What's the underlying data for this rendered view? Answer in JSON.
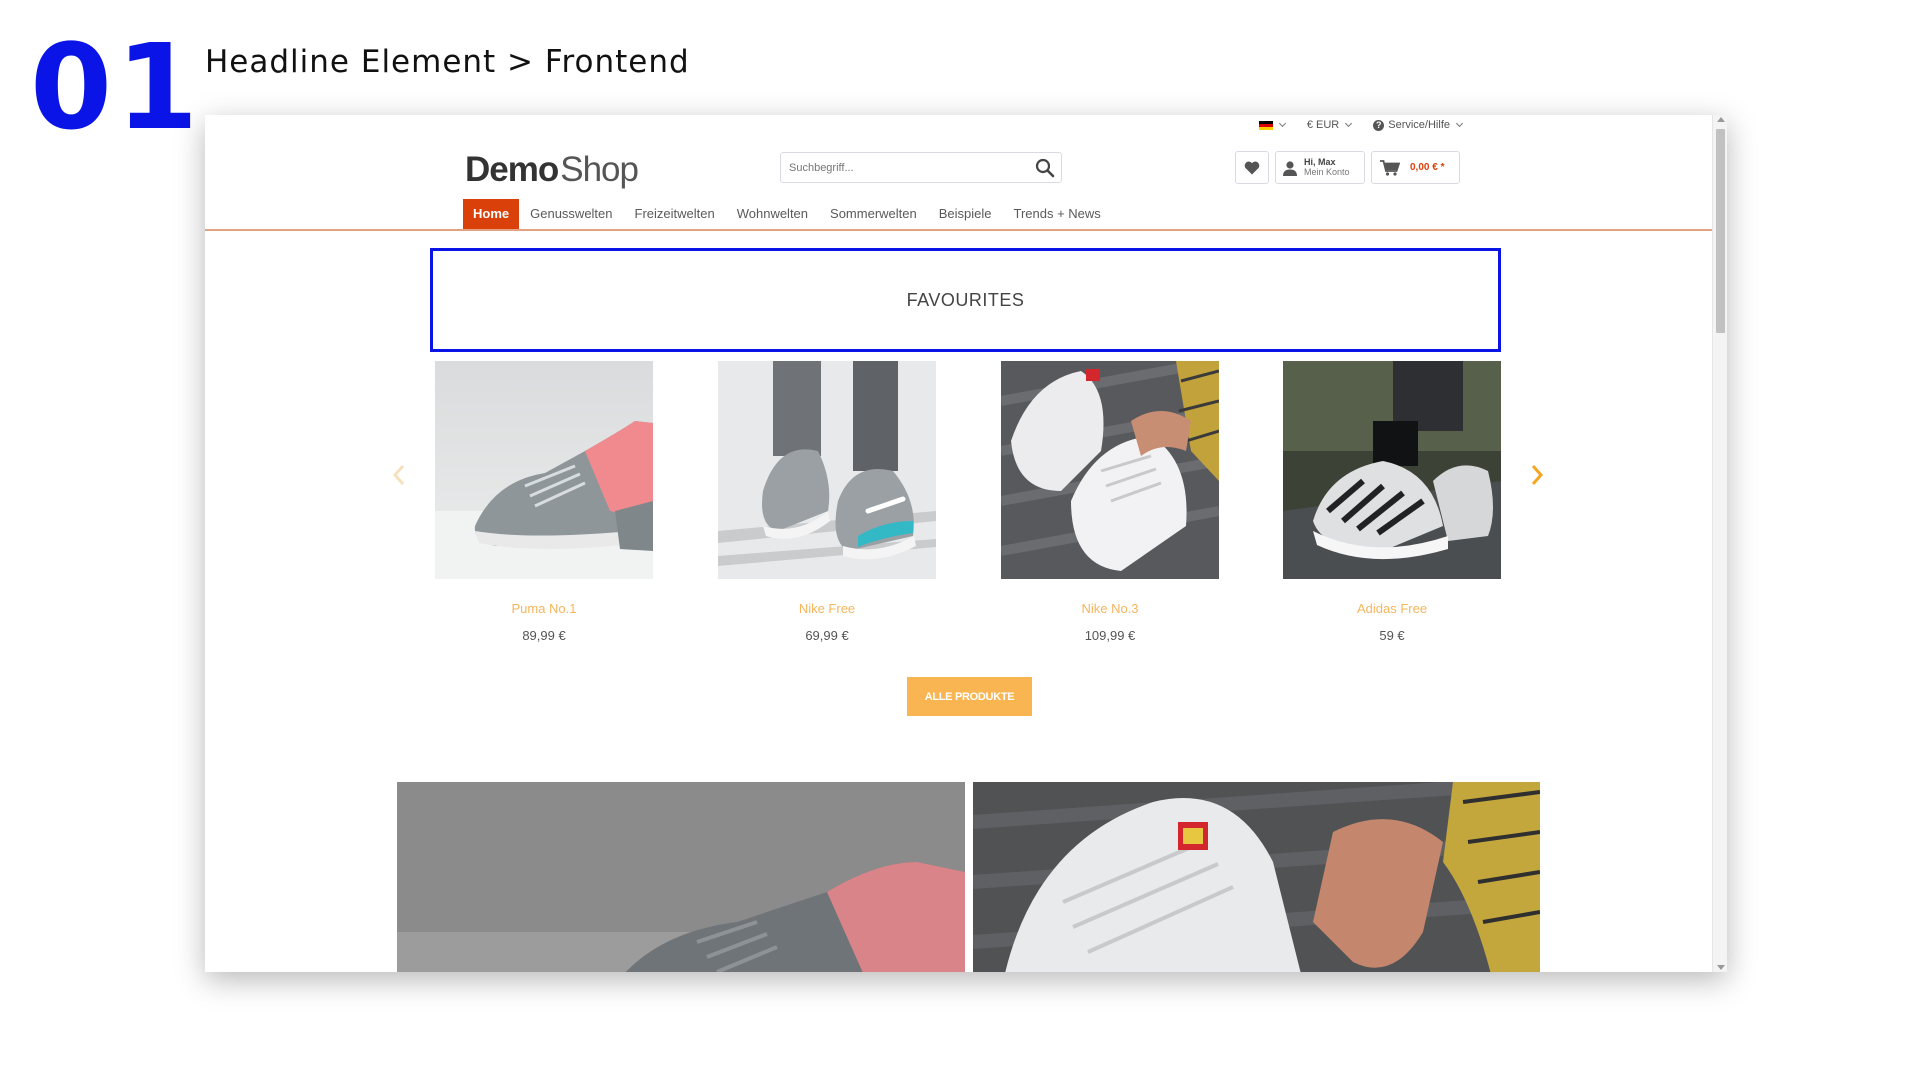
{
  "slide": {
    "number": "01",
    "title": "Headline Element > Frontend"
  },
  "topbar": {
    "currency": "€ EUR",
    "service": "Service/Hilfe"
  },
  "logo": {
    "part1": "Demo",
    "part2": "Shop"
  },
  "search": {
    "placeholder": "Suchbegriff..."
  },
  "account": {
    "greeting": "Hi, Max",
    "subtitle": "Mein Konto"
  },
  "cart": {
    "amount": "0,00 € *"
  },
  "nav": {
    "items": [
      {
        "label": "Home"
      },
      {
        "label": "Genusswelten"
      },
      {
        "label": "Freizeitwelten"
      },
      {
        "label": "Wohnwelten"
      },
      {
        "label": "Sommerwelten"
      },
      {
        "label": "Beispiele"
      },
      {
        "label": "Trends + News"
      }
    ]
  },
  "headline": {
    "text": "FAVOURITES"
  },
  "products": [
    {
      "name": "Puma No.1",
      "price": "89,99 €"
    },
    {
      "name": "Nike Free",
      "price": "69,99 €"
    },
    {
      "name": "Nike No.3",
      "price": "109,99 €"
    },
    {
      "name": "Adidas Free",
      "price": "59 €"
    }
  ],
  "all_products_button": "ALLE PRODUKTE",
  "colors": {
    "accent": "#d9400a",
    "button": "#f9b552",
    "product_name": "#f7b55c",
    "highlight_border": "#0a14e6"
  }
}
